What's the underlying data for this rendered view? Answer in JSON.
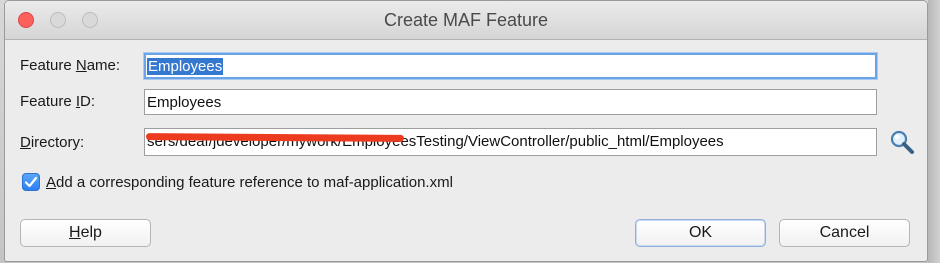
{
  "window": {
    "title": "Create MAF Feature"
  },
  "form": {
    "feature_name_label_prefix": "Feature ",
    "feature_name_label_mnemonic": "N",
    "feature_name_label_suffix": "ame:",
    "feature_name_value": "Employees",
    "feature_id_label_prefix": "Feature ",
    "feature_id_label_mnemonic": "I",
    "feature_id_label_suffix": "D:",
    "feature_id_value": "Employees",
    "directory_label_mnemonic": "D",
    "directory_label_suffix": "irectory:",
    "directory_value": "sers/deaf/jdeveloper/mywork/EmployeesTesting/ViewController/public_html/Employees",
    "add_reference_mnemonic": "A",
    "add_reference_label": "dd a corresponding feature reference to maf-application.xml",
    "add_reference_checked": true
  },
  "buttons": {
    "help_mnemonic": "H",
    "help_label": "elp",
    "ok_label": "OK",
    "cancel_label": "Cancel"
  },
  "icons": {
    "search": "magnifier-icon",
    "checkmark": "checkmark-icon"
  },
  "colors": {
    "accent": "#3478d0",
    "redaction": "#ec3b1f",
    "close": "#fc605c"
  }
}
